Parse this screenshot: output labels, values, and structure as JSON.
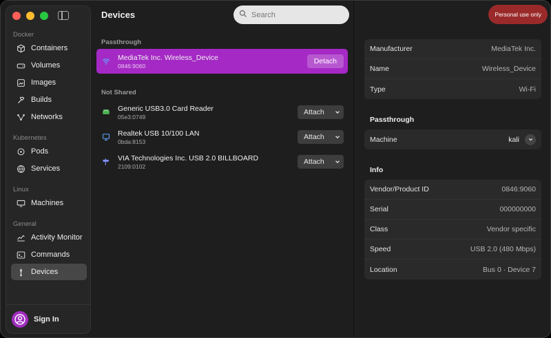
{
  "window": {
    "title": "Devices"
  },
  "sidebar": {
    "sections": [
      {
        "label": "Docker",
        "items": [
          {
            "label": "Containers",
            "icon": "cube-icon"
          },
          {
            "label": "Volumes",
            "icon": "drive-icon"
          },
          {
            "label": "Images",
            "icon": "image-icon"
          },
          {
            "label": "Builds",
            "icon": "hammer-icon"
          },
          {
            "label": "Networks",
            "icon": "network-icon"
          }
        ]
      },
      {
        "label": "Kubernetes",
        "items": [
          {
            "label": "Pods",
            "icon": "pod-icon"
          },
          {
            "label": "Services",
            "icon": "globe-icon"
          }
        ]
      },
      {
        "label": "Linux",
        "items": [
          {
            "label": "Machines",
            "icon": "monitor-icon"
          }
        ]
      },
      {
        "label": "General",
        "items": [
          {
            "label": "Activity Monitor",
            "icon": "activity-icon"
          },
          {
            "label": "Commands",
            "icon": "terminal-icon"
          },
          {
            "label": "Devices",
            "icon": "usb-icon",
            "active": true
          }
        ]
      }
    ],
    "sign_in": "Sign In"
  },
  "search": {
    "placeholder": "Search"
  },
  "devices": {
    "passthrough_label": "Passthrough",
    "not_shared_label": "Not Shared",
    "passthrough": [
      {
        "name": "MediaTek Inc. Wireless_Device",
        "id": "0846:9060",
        "action": "Detach",
        "icon": "wifi-icon"
      }
    ],
    "not_shared": [
      {
        "name": "Generic USB3.0 Card Reader",
        "id": "05e3:0749",
        "action": "Attach",
        "icon": "card-reader-icon"
      },
      {
        "name": "Realtek USB 10/100 LAN",
        "id": "0bda:8153",
        "action": "Attach",
        "icon": "ethernet-icon"
      },
      {
        "name": "VIA Technologies Inc. USB 2.0 BILLBOARD",
        "id": "2109:0102",
        "action": "Attach",
        "icon": "signpost-icon"
      }
    ]
  },
  "badge": "Personal use only",
  "details": {
    "general": [
      {
        "key": "Manufacturer",
        "value": "MediaTek Inc."
      },
      {
        "key": "Name",
        "value": "Wireless_Device"
      },
      {
        "key": "Type",
        "value": "Wi-Fi"
      }
    ],
    "passthrough_title": "Passthrough",
    "passthrough": {
      "key": "Machine",
      "value": "kali"
    },
    "info_title": "Info",
    "info": [
      {
        "key": "Vendor/Product ID",
        "value": "0846:9060"
      },
      {
        "key": "Serial",
        "value": "000000000"
      },
      {
        "key": "Class",
        "value": "Vendor specific"
      },
      {
        "key": "Speed",
        "value": "USB 2.0 (480 Mbps)"
      },
      {
        "key": "Location",
        "value": "Bus 0 · Device 7"
      }
    ]
  },
  "colors": {
    "accent": "#a529c5",
    "badge": "#9a2a2a",
    "wifi": "#5da8ff",
    "card_reader": "#4caf50",
    "lan": "#5da8ff",
    "billboard": "#7d8cff"
  }
}
